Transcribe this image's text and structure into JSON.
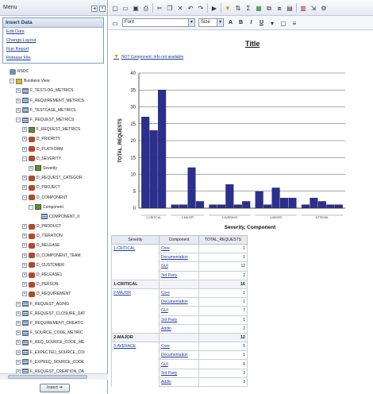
{
  "left": {
    "menu_title": "Menu",
    "insert_data": {
      "title": "Insert Data",
      "links": [
        "Edit Data",
        "Change Layout",
        "Run Report",
        "Release File"
      ]
    },
    "tree": [
      {
        "label": "RSDC",
        "indent": 0,
        "icon": "db",
        "toggle": ""
      },
      {
        "label": "Business View",
        "indent": 1,
        "icon": "folder",
        "toggle": "-"
      },
      {
        "label": "F_TESTLOG_METRICS",
        "indent": 2,
        "icon": "table",
        "toggle": "+"
      },
      {
        "label": "F_REQUIREMENT_METRICS",
        "indent": 2,
        "icon": "table",
        "toggle": "+"
      },
      {
        "label": "F_TESTCASE_METRICS",
        "indent": 2,
        "icon": "table",
        "toggle": "+"
      },
      {
        "label": "F_REQUEST_METRICS",
        "indent": 2,
        "icon": "table",
        "toggle": "-"
      },
      {
        "label": "F_REQUEST_METRICS",
        "indent": 3,
        "icon": "lvl",
        "toggle": "+"
      },
      {
        "label": "D_PRIORITY",
        "indent": 3,
        "icon": "dim",
        "toggle": "+"
      },
      {
        "label": "D_PLATFORM",
        "indent": 3,
        "icon": "dim",
        "toggle": "+"
      },
      {
        "label": "D_SEVERITY",
        "indent": 3,
        "icon": "dim",
        "toggle": "-"
      },
      {
        "label": "Severity",
        "indent": 4,
        "icon": "lvl",
        "toggle": "+"
      },
      {
        "label": "D_REQUEST_CATEGOR",
        "indent": 3,
        "icon": "dim",
        "toggle": "+"
      },
      {
        "label": "D_PROJECT",
        "indent": 3,
        "icon": "dim",
        "toggle": "+"
      },
      {
        "label": "D_COMPONENT",
        "indent": 3,
        "icon": "dim",
        "toggle": "-"
      },
      {
        "label": "Component",
        "indent": 4,
        "icon": "lvl",
        "toggle": "-"
      },
      {
        "label": "COMPONENT_II",
        "indent": 5,
        "icon": "table",
        "toggle": ""
      },
      {
        "label": "D_PRODUCT",
        "indent": 3,
        "icon": "dim",
        "toggle": "+"
      },
      {
        "label": "D_ITERATION",
        "indent": 3,
        "icon": "dim",
        "toggle": "+"
      },
      {
        "label": "D_RELEASE",
        "indent": 3,
        "icon": "dim",
        "toggle": "+"
      },
      {
        "label": "D_COMPONENT_TEAM",
        "indent": 3,
        "icon": "dim",
        "toggle": "+"
      },
      {
        "label": "D_CUSTOMER",
        "indent": 3,
        "icon": "dim",
        "toggle": "+"
      },
      {
        "label": "D_RELEASE1",
        "indent": 3,
        "icon": "dim",
        "toggle": "+"
      },
      {
        "label": "D_PERSON",
        "indent": 3,
        "icon": "dim",
        "toggle": "+"
      },
      {
        "label": "D_REQUIREMENT",
        "indent": 3,
        "icon": "dim",
        "toggle": "+"
      },
      {
        "label": "F_REQUEST_AGING",
        "indent": 2,
        "icon": "table",
        "toggle": "+"
      },
      {
        "label": "F_REQUEST_CLOSURE_DAT",
        "indent": 2,
        "icon": "table",
        "toggle": "+"
      },
      {
        "label": "F_REQUIREMENT_CREATIC",
        "indent": 2,
        "icon": "table",
        "toggle": "+"
      },
      {
        "label": "F_SOURCE_CODE_METRIC",
        "indent": 2,
        "icon": "table",
        "toggle": "+"
      },
      {
        "label": "F_REQ_SOURCE_CODE_ME",
        "indent": 2,
        "icon": "table",
        "toggle": "+"
      },
      {
        "label": "F_EXPECTED_SOURCE_COI",
        "indent": 2,
        "icon": "table",
        "toggle": "+"
      },
      {
        "label": "F_EXPREQ_SOURCE_CODE",
        "indent": 2,
        "icon": "table",
        "toggle": "+"
      },
      {
        "label": "F_REQUEST_CREATION_DA",
        "indent": 2,
        "icon": "table",
        "toggle": "+"
      }
    ],
    "insert_button": "Insert"
  },
  "toolbar": {
    "font_value": "Font",
    "size_value": "Size",
    "format_buttons": [
      "A",
      "B",
      "I",
      "U"
    ]
  },
  "report": {
    "title": "Title",
    "filter_note": "NOT Component: Info not available"
  },
  "chart_data": {
    "type": "bar",
    "ylabel": "TOTAL_REQUESTS",
    "xlabel": "Severity, Component",
    "ylim": [
      0,
      40
    ],
    "yticks": [
      0,
      5,
      10,
      15,
      20,
      25,
      30,
      35,
      40
    ],
    "groups": [
      {
        "name": "1-CRITICAL",
        "values": [
          27,
          23,
          35
        ]
      },
      {
        "name": "2-MAJOR",
        "values": [
          1,
          1,
          12,
          2
        ]
      },
      {
        "name": "3-AVERAGE",
        "values": [
          1,
          1,
          7,
          1,
          2
        ]
      },
      {
        "name": "4-MINOR",
        "values": [
          5,
          1,
          6,
          3,
          3
        ]
      },
      {
        "name": "5-TRIVIAL",
        "values": [
          1,
          3,
          2,
          1,
          1
        ]
      }
    ],
    "bar_color": "#2b2f8f"
  },
  "table": {
    "headers": [
      "Severity",
      "Component",
      "TOTAL_REQUESTS"
    ],
    "rows": [
      {
        "sev": "1-CRITICAL",
        "comp": "Core",
        "val": "1",
        "type": "data"
      },
      {
        "sev": "",
        "comp": "Documentation",
        "val": "1",
        "type": "data"
      },
      {
        "sev": "",
        "comp": "GUI",
        "val": "12",
        "type": "data"
      },
      {
        "sev": "",
        "comp": "3rd Party",
        "val": "2",
        "type": "data"
      },
      {
        "sev": "1-CRITICAL",
        "comp": "",
        "val": "16",
        "type": "sub"
      },
      {
        "sev": "2-MAJOR",
        "comp": "Core",
        "val": "1",
        "type": "data"
      },
      {
        "sev": "",
        "comp": "Documentation",
        "val": "1",
        "type": "data"
      },
      {
        "sev": "",
        "comp": "GUI",
        "val": "7",
        "type": "data"
      },
      {
        "sev": "",
        "comp": "3rd Party",
        "val": "1",
        "type": "data"
      },
      {
        "sev": "",
        "comp": "Addin",
        "val": "2",
        "type": "data"
      },
      {
        "sev": "2-MAJOR",
        "comp": "",
        "val": "12",
        "type": "sub"
      },
      {
        "sev": "3-AVERAGE",
        "comp": "Core",
        "val": "5",
        "type": "data"
      },
      {
        "sev": "",
        "comp": "Documentation",
        "val": "1",
        "type": "data"
      },
      {
        "sev": "",
        "comp": "GUI",
        "val": "6",
        "type": "data"
      },
      {
        "sev": "",
        "comp": "3rd Party",
        "val": "3",
        "type": "data"
      },
      {
        "sev": "",
        "comp": "Addin",
        "val": "3",
        "type": "data"
      }
    ]
  }
}
